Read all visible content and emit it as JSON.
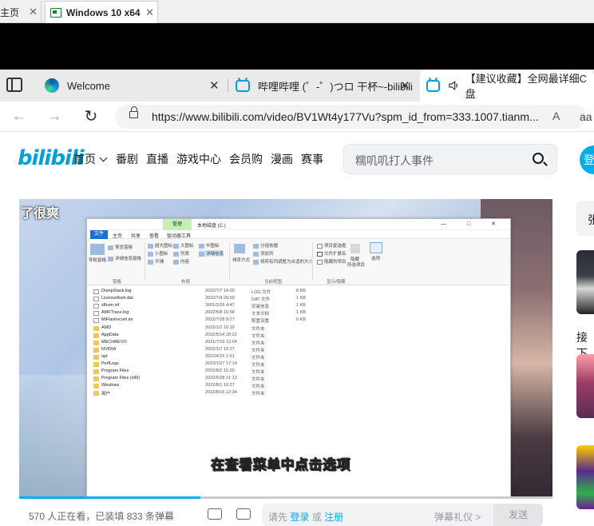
{
  "host_tabs": [
    {
      "label": "主页",
      "close": "✕"
    },
    {
      "label": "Windows 10 x64",
      "close": "✕"
    }
  ],
  "edge_tabs": [
    {
      "label": "Welcome",
      "close": "✕"
    },
    {
      "label": "哔哩哔哩 (゜-゜)つロ 干杯~-bilibili",
      "close": "✕"
    },
    {
      "label": "【建议收藏】全网最详细C 盘"
    }
  ],
  "address_bar": {
    "url": "https://www.bilibili.com/video/BV1Wt4y177Vu?spm_id_from=333.1007.tianm...",
    "read_aloud": "A",
    "aa": "aa"
  },
  "bili_header": {
    "logo": "bilibili",
    "nav": [
      "首页",
      "番剧",
      "直播",
      "游戏中心",
      "会员购",
      "漫画",
      "赛事"
    ],
    "search_placeholder": "糯叽叽打人事件",
    "login": "登"
  },
  "player": {
    "overlay_text": "了很爽",
    "subtitle": "在查看菜单中点击选项",
    "progress_fraction": 0.34
  },
  "explorer": {
    "manage_tab": "管理",
    "drive_title": "本地磁盘 (C:)",
    "window_buttons": "—  □  ✕",
    "menu": [
      "文件",
      "主页",
      "共享",
      "查看",
      "驱动器工具"
    ],
    "ribbon": {
      "nav_pane": "导航窗格",
      "preview_pane": "预览窗格",
      "details_pane": "详细信息窗格",
      "layout_items": [
        "超大图标",
        "大图标",
        "中图标",
        "小图标",
        "列表",
        "详细信息",
        "平铺",
        "内容"
      ],
      "sort_by": "排序方式",
      "group_by": "分组依据",
      "add_columns": "添加列",
      "fit_columns": "将所有列调整为合适的大小",
      "item_checkboxes": "项目复选框",
      "file_ext": "文件扩展名",
      "hidden_items": "隐藏的项目",
      "hide_selected": "隐藏",
      "selected_items": "所选项目",
      "options": "选项",
      "groups": [
        "窗格",
        "布局",
        "当前视图",
        "显示/隐藏"
      ]
    },
    "rows": [
      {
        "name": "DumpStack.log",
        "date": "2022/7/7 14:25",
        "type": "LOG 文件",
        "size": "8 KB",
        "kind": "file"
      },
      {
        "name": "License8ssh.dat",
        "date": "2022/7/4 20:59",
        "type": "DAT 文件",
        "size": "1 KB",
        "kind": "file"
      },
      {
        "name": "xfhum.inf",
        "date": "2001/2/26 4:47",
        "type": "安装信息",
        "size": "1 KB",
        "kind": "file"
      },
      {
        "name": "AMFTrace.log",
        "date": "2022/6/8 16:58",
        "type": "文本文档",
        "size": "1 KB",
        "kind": "file"
      },
      {
        "name": "MiFlashvcom.ini",
        "date": "2022/7/28 9:27",
        "type": "配置设置",
        "size": "0 KB",
        "kind": "file"
      },
      {
        "name": "AMD",
        "date": "2022/1/2 10:19",
        "type": "文件夹",
        "size": "",
        "kind": "folder"
      },
      {
        "name": "AppData",
        "date": "2022/5/14 20:22",
        "type": "文件夹",
        "size": "",
        "kind": "folder"
      },
      {
        "name": "MECHREVO",
        "date": "2021/7/19 12:04",
        "type": "文件夹",
        "size": "",
        "kind": "folder"
      },
      {
        "name": "NVIDIA",
        "date": "2022/1/7 10:27",
        "type": "文件夹",
        "size": "",
        "kind": "folder"
      },
      {
        "name": "opt",
        "date": "2022/4/16 1:51",
        "type": "文件夹",
        "size": "",
        "kind": "folder"
      },
      {
        "name": "PerfLogs",
        "date": "2019/12/7 17:14",
        "type": "文件夹",
        "size": "",
        "kind": "folder"
      },
      {
        "name": "Program Files",
        "date": "2022/8/2 15:20",
        "type": "文件夹",
        "size": "",
        "kind": "folder"
      },
      {
        "name": "Program Files (x86)",
        "date": "2022/6/28 21:13",
        "type": "文件夹",
        "size": "",
        "kind": "folder"
      },
      {
        "name": "Windows",
        "date": "2022/8/1 10:27",
        "type": "文件夹",
        "size": "",
        "kind": "folder"
      },
      {
        "name": "用户",
        "date": "2022/8/16 12:34",
        "type": "文件夹",
        "size": "",
        "kind": "folder"
      }
    ]
  },
  "danmaku_bar": {
    "viewers": "570 人正在看，已装填 833 条弹幕",
    "input_pre": "请先",
    "login_link": "登录",
    "or": "或",
    "register_link": "注册",
    "etiquette": "弹幕礼仪 >",
    "send": "发送"
  },
  "sidebar": {
    "up_label": "张",
    "next_label": "接下"
  },
  "colors": {
    "bili_blue": "#00aeec",
    "logo_blue": "#00a1d6"
  }
}
